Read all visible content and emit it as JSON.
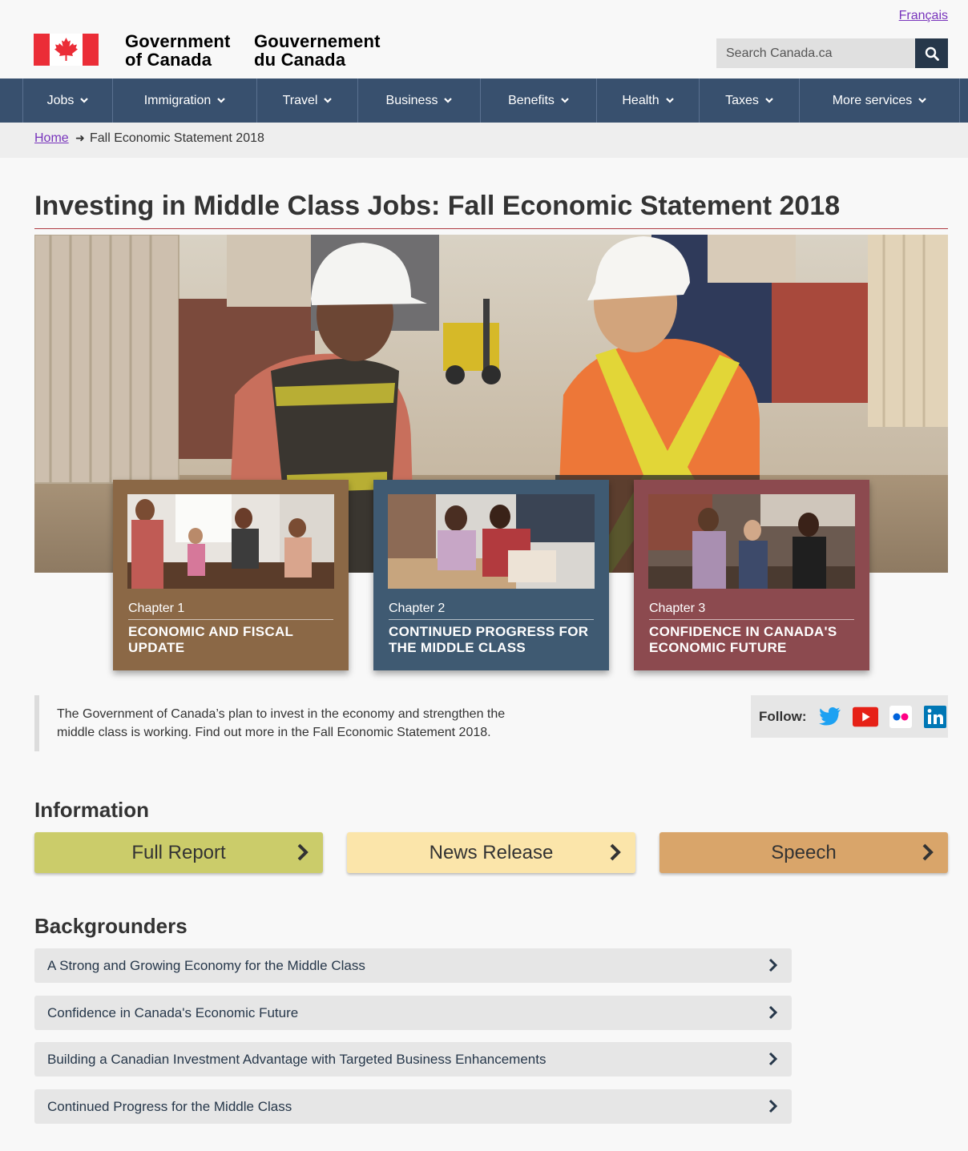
{
  "header": {
    "language_link": "Français",
    "signature_en_line1": "Government",
    "signature_en_line2": "of Canada",
    "signature_fr_line1": "Gouvernement",
    "signature_fr_line2": "du Canada",
    "search_placeholder": "Search Canada.ca"
  },
  "menu": {
    "items": [
      {
        "label": "Jobs"
      },
      {
        "label": "Immigration"
      },
      {
        "label": "Travel"
      },
      {
        "label": "Business"
      },
      {
        "label": "Benefits"
      },
      {
        "label": "Health"
      },
      {
        "label": "Taxes"
      },
      {
        "label": "More services"
      }
    ]
  },
  "breadcrumb": {
    "home": "Home",
    "arrow": "➜",
    "current": "Fall Economic Statement 2018"
  },
  "main": {
    "title": "Investing in Middle Class Jobs: Fall Economic Statement 2018",
    "intro_line1": "The Government of Canada’s plan to invest in the economy and strengthen the",
    "intro_line2": "middle class is working. Find out more in the Fall Economic Statement 2018."
  },
  "chapters": [
    {
      "chapter": "Chapter 1",
      "title": "Economic and Fiscal Update",
      "color": "#8b6846"
    },
    {
      "chapter": "Chapter 2",
      "title": "Continued Progress for the Middle Class",
      "color": "#3f5a72"
    },
    {
      "chapter": "Chapter 3",
      "title": "Confidence in Canada's Economic Future",
      "color": "#8c4a4f"
    }
  ],
  "follow": {
    "label": "Follow:",
    "icons": [
      "twitter-icon",
      "youtube-icon",
      "flickr-icon",
      "linkedin-icon"
    ]
  },
  "information": {
    "heading": "Information",
    "buttons": [
      {
        "label": "Full Report",
        "color": "#cbcc6a"
      },
      {
        "label": "News Release",
        "color": "#fbe5aa"
      },
      {
        "label": "Speech",
        "color": "#d9a56a"
      }
    ]
  },
  "backgrounders": {
    "heading": "Backgrounders",
    "items": [
      {
        "label": "A Strong and Growing Economy for the Middle Class"
      },
      {
        "label": "Confidence in Canada's Economic Future"
      },
      {
        "label": "Building a Canadian Investment Advantage with Targeted Business Enhancements"
      },
      {
        "label": "Continued Progress for the Middle Class"
      }
    ]
  }
}
